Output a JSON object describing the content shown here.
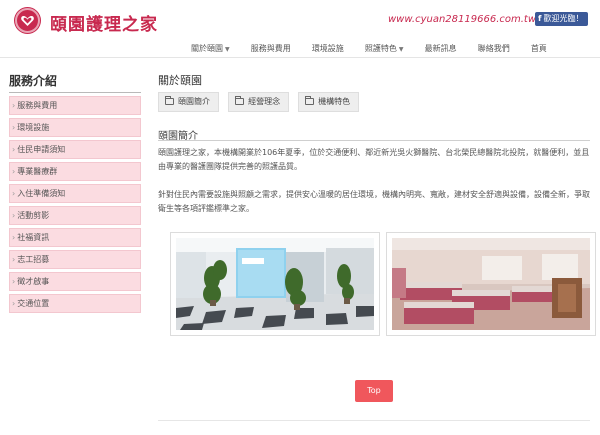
{
  "brand": {
    "name": "頤園護理之家",
    "url": "www.cyuan28119666.com.tw",
    "facebook_label": "歡迎光臨！",
    "accent_color": "#c8294f"
  },
  "nav": {
    "items": [
      {
        "label": "關於頤園",
        "has_caret": true
      },
      {
        "label": "服務與費用",
        "has_caret": false
      },
      {
        "label": "環境設施",
        "has_caret": false
      },
      {
        "label": "照護特色",
        "has_caret": true
      },
      {
        "label": "最新訊息",
        "has_caret": false
      },
      {
        "label": "聯絡我們",
        "has_caret": false
      },
      {
        "label": "首頁",
        "has_caret": false
      }
    ]
  },
  "sidebar": {
    "title": "服務介紹",
    "items": [
      {
        "label": "服務與費用"
      },
      {
        "label": "環境設施"
      },
      {
        "label": "住民申請須知"
      },
      {
        "label": "專業醫療群"
      },
      {
        "label": "入住準備須知"
      },
      {
        "label": "活動剪影"
      },
      {
        "label": "社福資訊"
      },
      {
        "label": "志工招募"
      },
      {
        "label": "徵才啟事"
      },
      {
        "label": "交通位置"
      }
    ]
  },
  "main": {
    "section_title": "關於頤園",
    "tabs": [
      {
        "label": "頤園簡介"
      },
      {
        "label": "經營理念"
      },
      {
        "label": "機構特色"
      }
    ],
    "subtitle": "頤園簡介",
    "paragraph_1": "頤園護理之家，本機構開業於106年夏季，位於交通便利、鄰近新光吳火獅醫院、台北榮民總醫院北投院，就醫便利，並且由專業的醫護團隊提供完善的照護品質。",
    "paragraph_2": "針對住民內需要設施與照顧之需求，提供安心溫暖的居住環境，機構內明亮、寬敞，建材安全舒適與設備，設備全新，爭取衛生等各項評鑑標準之家。",
    "photos": [
      {
        "alt": "lobby-photo"
      },
      {
        "alt": "ward-photo"
      }
    ],
    "top_button_label": "Top"
  }
}
